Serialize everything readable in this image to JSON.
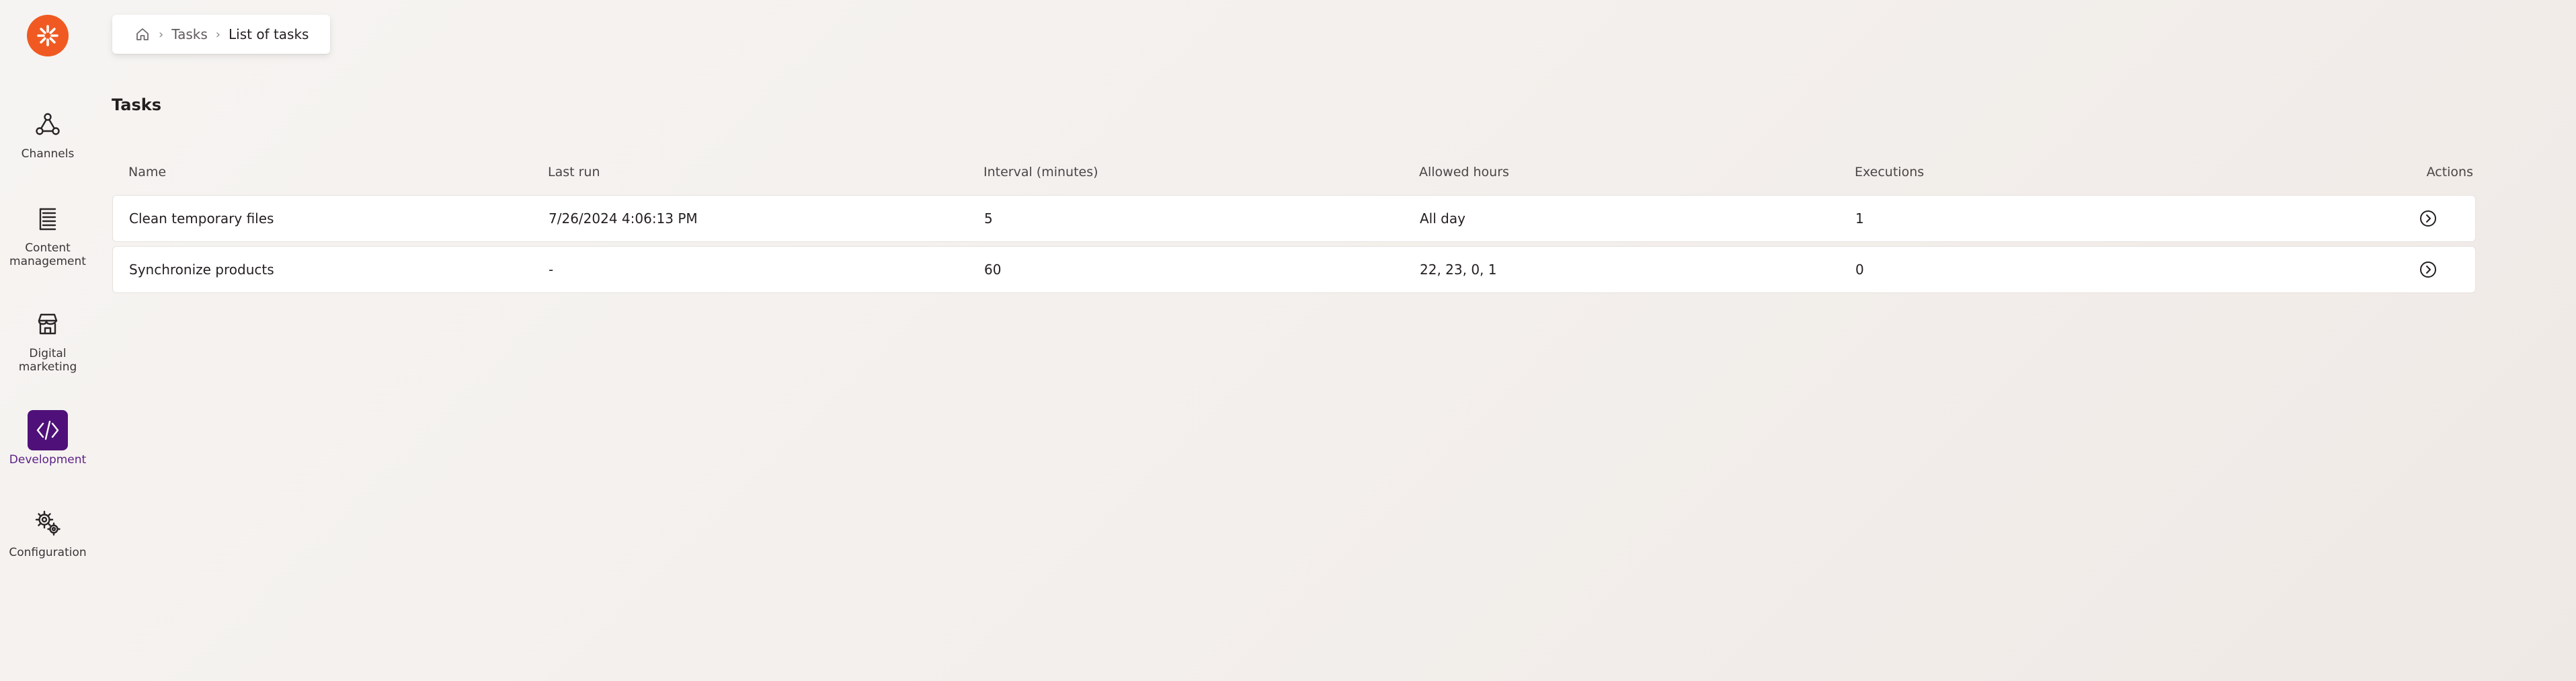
{
  "nav": {
    "logo_icon": "asterisk-logo-icon",
    "brand_color": "#f05a22",
    "active_color": "#4f1179",
    "items": [
      {
        "label": "Channels",
        "icon": "share-nodes-icon",
        "active": false
      },
      {
        "label": "Content management",
        "icon": "content-list-icon",
        "active": false
      },
      {
        "label": "Digital marketing",
        "icon": "storefront-icon",
        "active": false
      },
      {
        "label": "Development",
        "icon": "code-icon",
        "active": true
      },
      {
        "label": "Configuration",
        "icon": "gears-icon",
        "active": false
      }
    ]
  },
  "breadcrumb": {
    "home_icon": "home-icon",
    "items": [
      "Tasks",
      "List of tasks"
    ]
  },
  "page": {
    "title": "Tasks"
  },
  "table": {
    "columns": [
      "Name",
      "Last run",
      "Interval (minutes)",
      "Allowed hours",
      "Executions",
      "Actions"
    ],
    "rows": [
      {
        "name": "Clean temporary files",
        "last_run": "7/26/2024 4:06:13 PM",
        "interval": "5",
        "allowed_hours": "All day",
        "executions": "1",
        "action_icon": "chevron-circle-right-icon"
      },
      {
        "name": "Synchronize products",
        "last_run": "-",
        "interval": "60",
        "allowed_hours": "22, 23, 0, 1",
        "executions": "0",
        "action_icon": "chevron-circle-right-icon"
      }
    ]
  }
}
